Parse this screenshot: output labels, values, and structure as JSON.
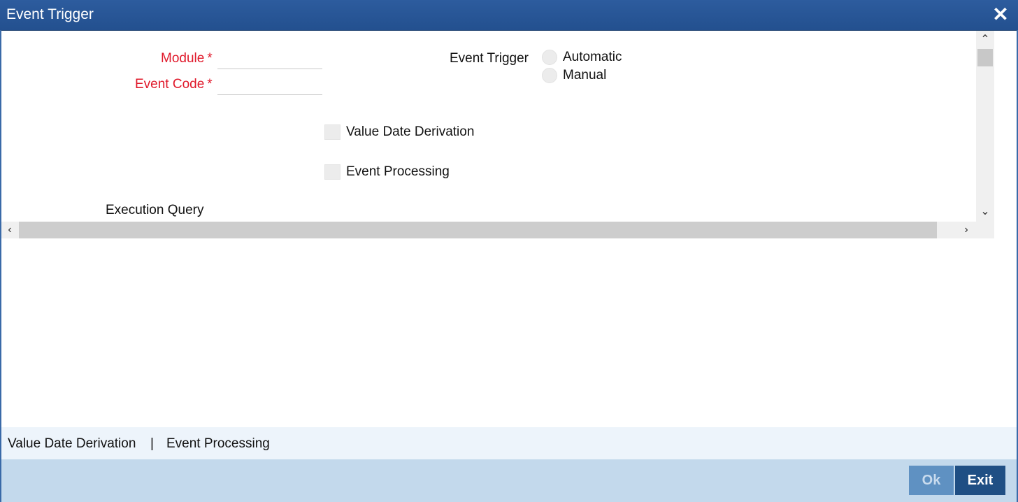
{
  "window": {
    "title": "Event Trigger",
    "close_glyph": "✕"
  },
  "form": {
    "module_label": "Module",
    "event_code_label": "Event Code",
    "required_mark": "*",
    "module_value": "",
    "event_code_value": "",
    "event_trigger_label": "Event Trigger",
    "trigger_options": [
      "Automatic",
      "Manual"
    ],
    "value_date_derivation_label": "Value Date Derivation",
    "event_processing_label": "Event Processing",
    "execution_query_label": "Execution Query"
  },
  "scrollbars": {
    "up": "⌃",
    "down": "⌄",
    "left": "‹",
    "right": "›"
  },
  "subtabs": {
    "items": [
      "Value Date Derivation",
      "Event Processing"
    ],
    "separator": "|"
  },
  "footer": {
    "ok_label": "Ok",
    "exit_label": "Exit"
  },
  "colors": {
    "titlebar": "#23508f",
    "required": "#e0182a",
    "footer": "#c3d9ec",
    "subbar": "#edf4fb",
    "exit_button": "#1f4f84",
    "ok_button": "#5f91c2"
  }
}
